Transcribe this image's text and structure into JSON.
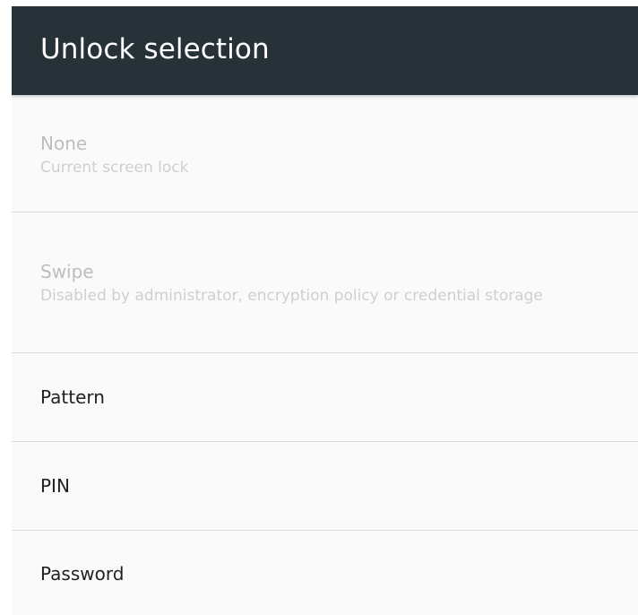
{
  "appbar": {
    "title": "Unlock selection"
  },
  "options": [
    {
      "title": "None",
      "summary": "Current screen lock",
      "enabled": false
    },
    {
      "title": "Swipe",
      "summary": "Disabled by administrator, encryption policy or credential storage",
      "enabled": false
    },
    {
      "title": "Pattern",
      "enabled": true
    },
    {
      "title": "PIN",
      "enabled": true
    },
    {
      "title": "Password",
      "enabled": true
    }
  ],
  "colors": {
    "appbar": "#263238",
    "background": "#fafafa",
    "divider": "#dcdcdc",
    "text_primary": "#212121",
    "text_disabled": "#bdbdbd"
  }
}
